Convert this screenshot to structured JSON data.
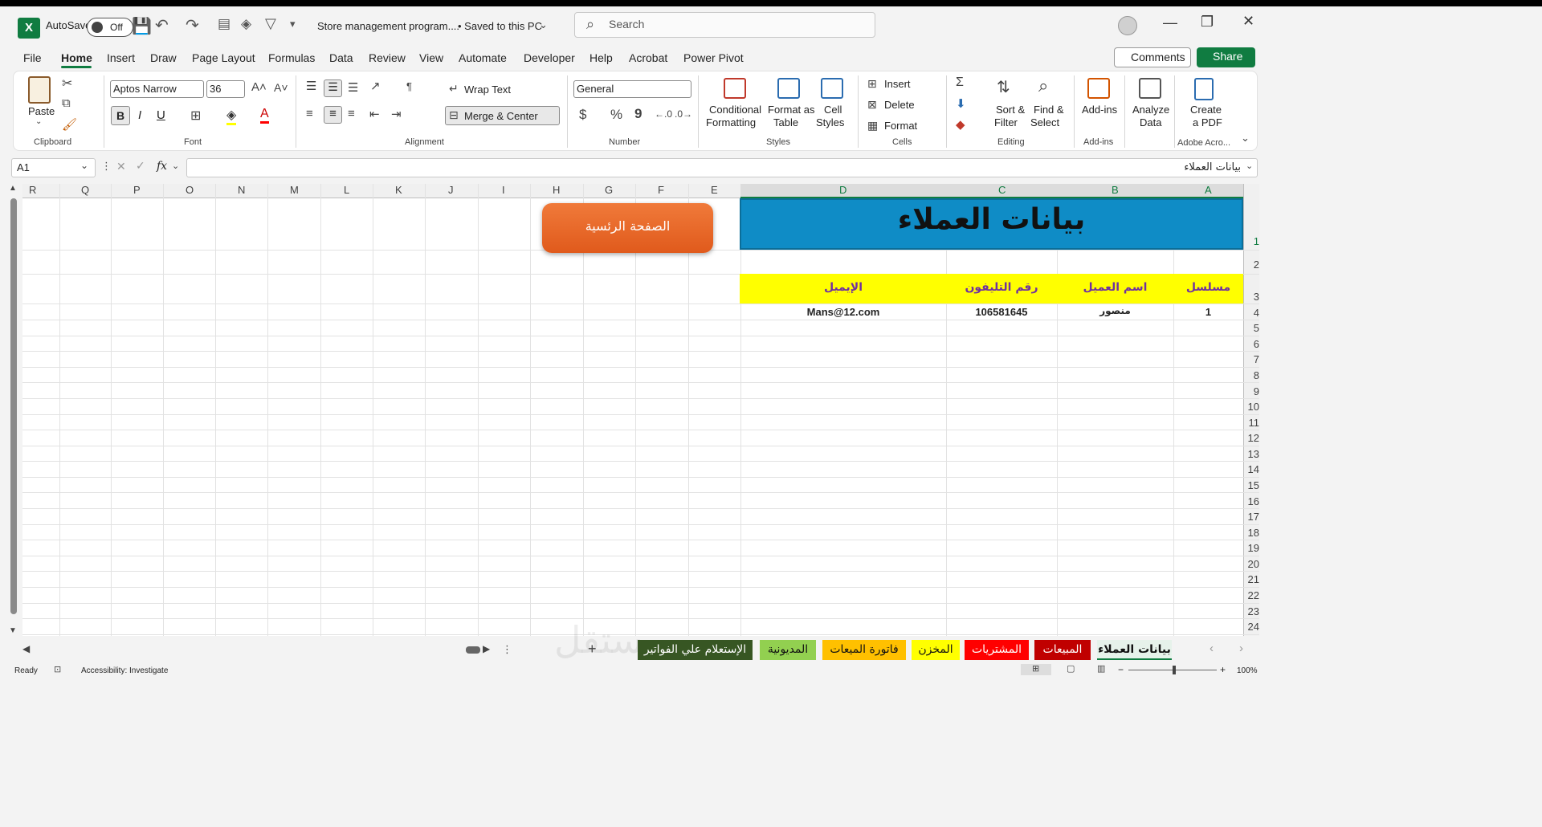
{
  "titlebar": {
    "autosave_label": "AutoSave",
    "toggle_state": "Off",
    "doc_title": "Store management program....",
    "save_status": "• Saved to this PC",
    "search_placeholder": "Search"
  },
  "menu": {
    "tabs": [
      "File",
      "Home",
      "Insert",
      "Draw",
      "Page Layout",
      "Formulas",
      "Data",
      "Review",
      "View",
      "Automate",
      "Developer",
      "Help",
      "Acrobat",
      "Power Pivot"
    ],
    "active": "Home",
    "comments_label": "Comments",
    "share_label": "Share"
  },
  "ribbon": {
    "clipboard": {
      "paste": "Paste",
      "group": "Clipboard"
    },
    "font": {
      "name": "Aptos Narrow",
      "size": "36",
      "bold": "B",
      "italic": "I",
      "underline": "U",
      "group": "Font"
    },
    "alignment": {
      "wrap": "Wrap Text",
      "merge": "Merge & Center",
      "group": "Alignment"
    },
    "number": {
      "format": "General",
      "currency": "$",
      "percent": "%",
      "comma": "9",
      "group": "Number"
    },
    "styles": {
      "conditional": [
        "Conditional",
        "Formatting"
      ],
      "format_table": [
        "Format as",
        "Table"
      ],
      "cell_styles": [
        "Cell",
        "Styles"
      ],
      "group": "Styles"
    },
    "cells": {
      "insert": "Insert",
      "delete": "Delete",
      "format": "Format",
      "group": "Cells"
    },
    "editing": {
      "sort": [
        "Sort &",
        "Filter"
      ],
      "find": [
        "Find &",
        "Select"
      ],
      "group": "Editing"
    },
    "addins": {
      "label": "Add-ins",
      "group": "Add-ins"
    },
    "analyze": {
      "label": [
        "Analyze",
        "Data"
      ]
    },
    "acrobat": {
      "label": [
        "Create",
        "a PDF"
      ],
      "group": "Adobe Acro..."
    }
  },
  "formula_bar": {
    "name_box": "A1",
    "fx": "fx",
    "value": "بيانات العملاء"
  },
  "grid": {
    "columns": [
      "R",
      "Q",
      "P",
      "O",
      "N",
      "M",
      "L",
      "K",
      "J",
      "I",
      "H",
      "G",
      "F",
      "E",
      "D",
      "C",
      "B",
      "A"
    ],
    "rows": [
      "1",
      "2",
      "3",
      "4",
      "5",
      "6",
      "7",
      "8",
      "9",
      "10",
      "11",
      "12",
      "13",
      "14",
      "15",
      "16",
      "17",
      "18",
      "19",
      "20",
      "21",
      "22",
      "23",
      "24"
    ],
    "title": "بيانات العملاء",
    "headers": {
      "serial": "مسلسل",
      "name": "اسم العميل",
      "phone": "رقم التليفون",
      "email": "الإيميل"
    },
    "record": {
      "serial": "1",
      "name": "منصور",
      "phone": "106581645",
      "email": "Mans@12.com"
    },
    "home_button": "الصفحة الرئسية"
  },
  "sheet_tabs": [
    {
      "label": "بيانات العملاء",
      "bg": "#e6f2ea",
      "color": "#111"
    },
    {
      "label": "المبيعات",
      "bg": "#c00000",
      "color": "#fff"
    },
    {
      "label": "المشتريات",
      "bg": "#ff0000",
      "color": "#fff"
    },
    {
      "label": "المخزن",
      "bg": "#ffff00",
      "color": "#111"
    },
    {
      "label": "فاتورة الميعات",
      "bg": "#ffc000",
      "color": "#111"
    },
    {
      "label": "المديونية",
      "bg": "#92d050",
      "color": "#111"
    },
    {
      "label": "الإستعلام علي الفواتير",
      "bg": "#375623",
      "color": "#fff"
    }
  ],
  "watermark": "مستقل",
  "status": {
    "ready": "Ready",
    "accessibility": "Accessibility: Investigate",
    "zoom": "100%"
  },
  "colors": {
    "accent": "#107c41",
    "title_fill": "#0f8cc6",
    "header_fill": "#ffff00",
    "header_text": "#7030a0",
    "button_fill": "#e8652a"
  }
}
